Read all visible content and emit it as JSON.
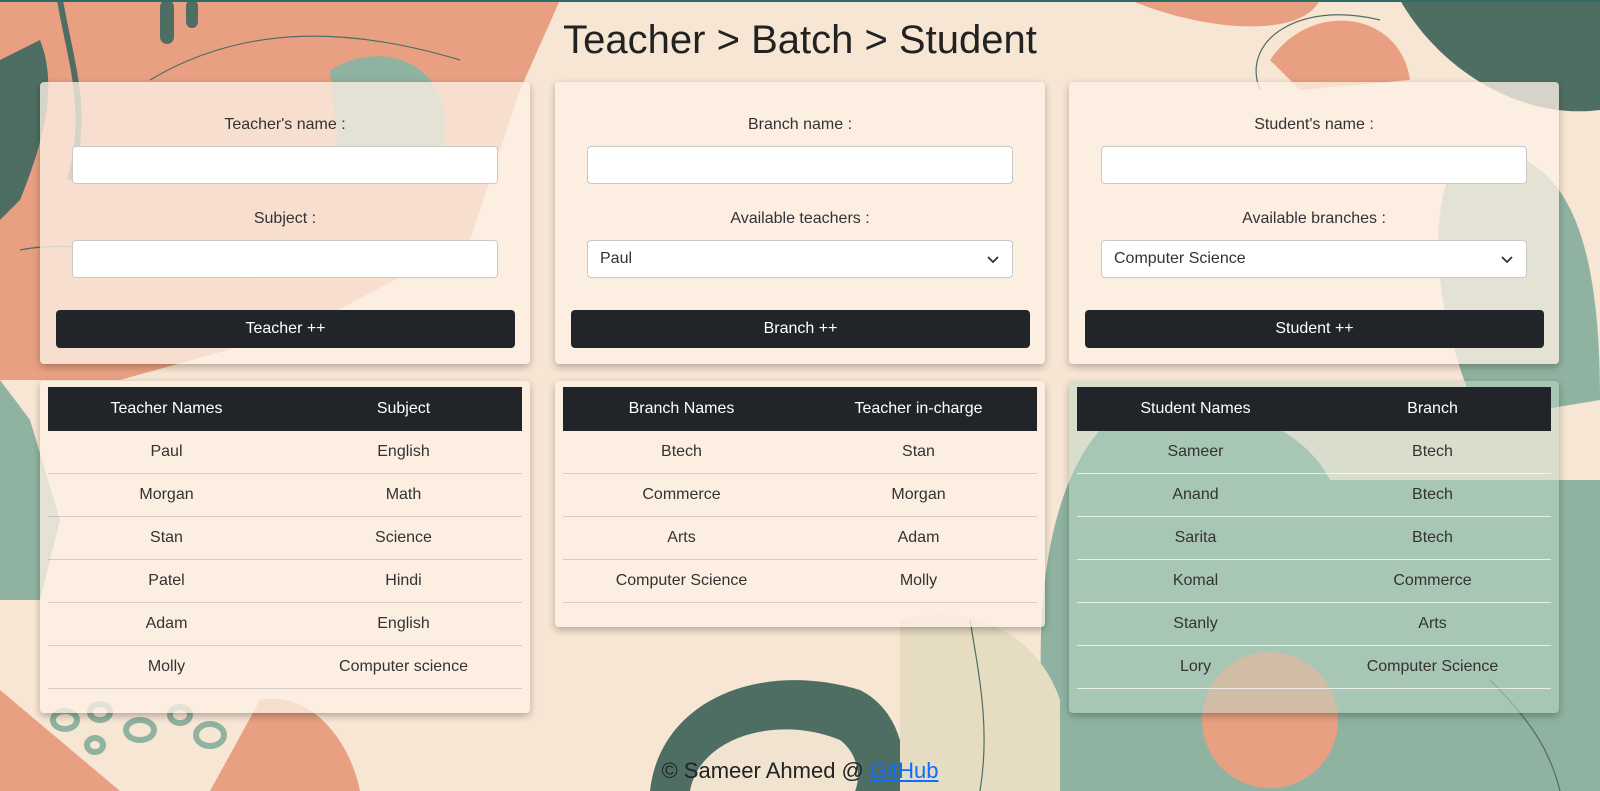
{
  "title": "Teacher > Batch > Student",
  "teacher_form": {
    "name_label": "Teacher's name :",
    "name_value": "",
    "subject_label": "Subject :",
    "subject_value": "",
    "button": "Teacher ++"
  },
  "branch_form": {
    "name_label": "Branch name :",
    "name_value": "",
    "teachers_label": "Available teachers :",
    "teachers_selected": "Paul",
    "button": "Branch ++"
  },
  "student_form": {
    "name_label": "Student's name :",
    "name_value": "",
    "branches_label": "Available branches :",
    "branches_selected": "Computer Science",
    "button": "Student ++"
  },
  "teacher_table": {
    "headers": [
      "Teacher Names",
      "Subject"
    ],
    "rows": [
      [
        "Paul",
        "English"
      ],
      [
        "Morgan",
        "Math"
      ],
      [
        "Stan",
        "Science"
      ],
      [
        "Patel",
        "Hindi"
      ],
      [
        "Adam",
        "English"
      ],
      [
        "Molly",
        "Computer science"
      ]
    ]
  },
  "branch_table": {
    "headers": [
      "Branch Names",
      "Teacher in-charge"
    ],
    "rows": [
      [
        "Btech",
        "Stan"
      ],
      [
        "Commerce",
        "Morgan"
      ],
      [
        "Arts",
        "Adam"
      ],
      [
        "Computer Science",
        "Molly"
      ]
    ]
  },
  "student_table": {
    "headers": [
      "Student Names",
      "Branch"
    ],
    "rows": [
      [
        "Sameer",
        "Btech"
      ],
      [
        "Anand",
        "Btech"
      ],
      [
        "Sarita",
        "Btech"
      ],
      [
        "Komal",
        "Commerce"
      ],
      [
        "Stanly",
        "Arts"
      ],
      [
        "Lory",
        "Computer Science"
      ]
    ]
  },
  "footer": {
    "text": "© Sameer Ahmed @ ",
    "link": "GitHub"
  },
  "colors": {
    "background": "#f7e3d0",
    "salmon": "#e9a082",
    "sage": "#8fb3a0",
    "dark_green": "#4f6e63",
    "button": "#212529",
    "link": "#0d6efd"
  }
}
